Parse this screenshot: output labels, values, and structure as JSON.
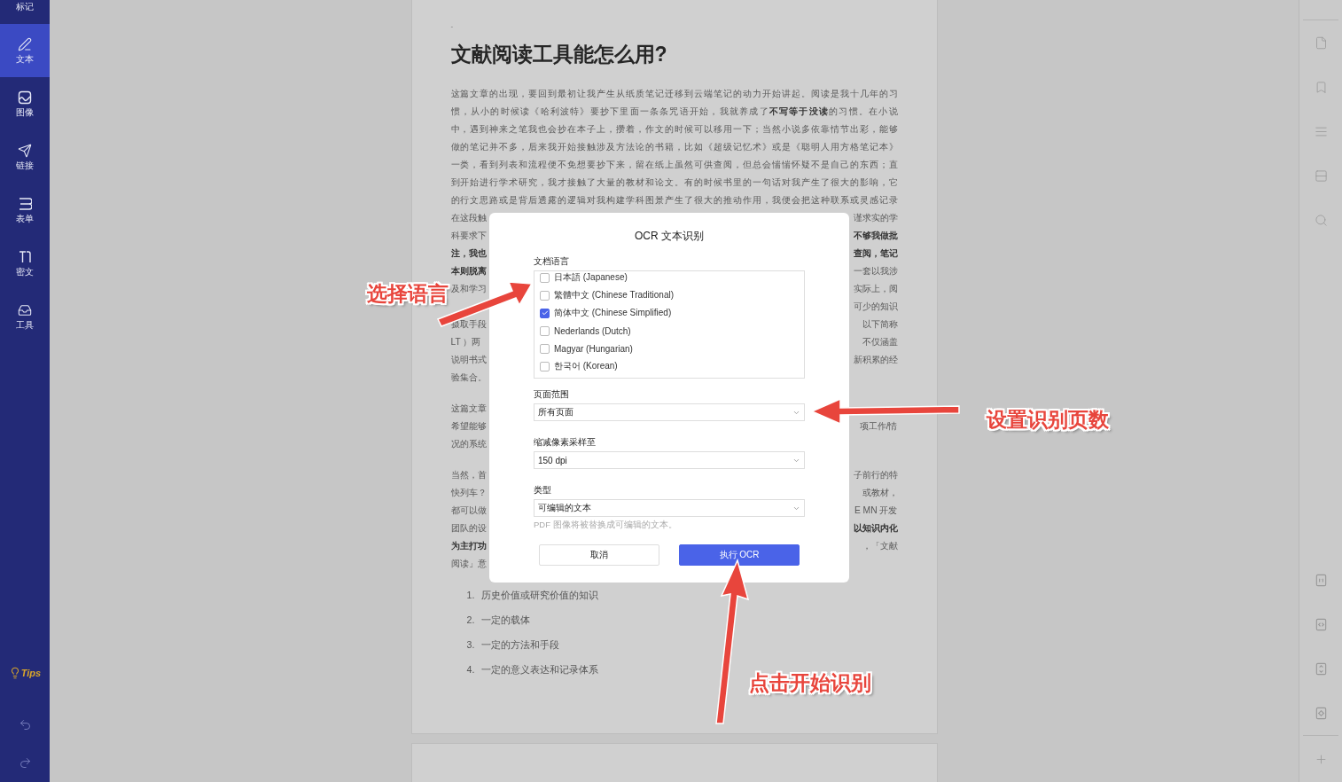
{
  "left_sidebar": {
    "items": [
      {
        "label": "标记",
        "selected": false
      },
      {
        "label": "文本",
        "selected": true
      },
      {
        "label": "图像",
        "selected": false
      },
      {
        "label": "链接",
        "selected": false
      },
      {
        "label": "表单",
        "selected": false
      },
      {
        "label": "密文",
        "selected": false
      },
      {
        "label": "工具",
        "selected": false
      }
    ],
    "tips": "Tips"
  },
  "document": {
    "marker": "-",
    "title": "文献阅读工具能怎么用?",
    "paragraphs": [
      [
        {
          "text": "这篇文章的出现，要回到最初让我产生从纸质笔记迁移到云端笔记的动力开始讲起。阅读是我十几年的习"
        },
        {
          "text": "惯，从小的时候读《哈利波特》要抄下里面一条条咒语开始，我就养成了**不写等于没读**的习惯。在小说"
        },
        {
          "text": "中，遇到神来之笔我也会抄在本子上，攒着，作文的时候可以移用一下；当然小说多依靠情节出彩，能够"
        },
        {
          "text": "做的笔记并不多，后来我开始接触涉及方法论的书籍，比如《超级记忆术》或是《聪明人用方格笔记本》"
        },
        {
          "text": "一类，看到列表和流程便不免想要抄下来，留在纸上虽然可供查阅，但总会惴惴怀疑不是自己的东西；直"
        },
        {
          "text": "到开始进行学术研究，我才接触了大量的教材和论文。有的时候书里的一句话对我产生了很大的影响，它"
        },
        {
          "text": "的行文思路或是背后透露的逻辑对我构建学科图景产生了很大的推动作用，我便会把这种联系或灵感记录"
        },
        {
          "left": "在这段触",
          "right": "谨求实的学"
        },
        {
          "left": "科要求下",
          "right": "**不够我做批**"
        },
        {
          "left": "**注，我也**",
          "right": "**查阅，笔记**"
        },
        {
          "left": "**本则脱离**",
          "right": "一套以我涉"
        },
        {
          "left": "及和学习",
          "right": "实际上，阅"
        },
        {
          "right": "可少的知识"
        },
        {
          "left": "摄取手段",
          "right": "以下简称"
        },
        {
          "left": "LT ）两",
          "right": "不仅涵盖"
        },
        {
          "left": "说明书式",
          "right": "新积累的经"
        },
        {
          "left": "验集合。"
        }
      ],
      [
        {
          "left": "这篇文章"
        },
        {
          "left": "希望能够",
          "right": "项工作/情"
        },
        {
          "left": "况的系统"
        }
      ],
      [
        {
          "left": "当然，首",
          "right": "子前行的特"
        },
        {
          "left": "快列车？",
          "right": "或教材，"
        },
        {
          "left": "都可以做",
          "right": "E MN 开发"
        },
        {
          "left": "团队的设",
          "right": "**以知识内化**"
        },
        {
          "left": "**为主打功**",
          "right": "，「文献"
        },
        {
          "left": "阅读」意"
        }
      ]
    ],
    "list": [
      {
        "number": "1.",
        "text": "历史价值或研究价值的知识"
      },
      {
        "number": "2.",
        "text": "一定的载体"
      },
      {
        "number": "3.",
        "text": "一定的方法和手段"
      },
      {
        "number": "4.",
        "text": "一定的意义表达和记录体系"
      }
    ]
  },
  "dialog": {
    "title": "OCR 文本识别",
    "language_label": "文档语言",
    "languages": [
      {
        "label": "日本語 (Japanese)",
        "checked": false
      },
      {
        "label": "繁體中文 (Chinese Traditional)",
        "checked": false
      },
      {
        "label": "简体中文 (Chinese Simplified)",
        "checked": true
      },
      {
        "label": "Nederlands (Dutch)",
        "checked": false
      },
      {
        "label": "Magyar (Hungarian)",
        "checked": false
      },
      {
        "label": "한국어 (Korean)",
        "checked": false
      }
    ],
    "fields": [
      {
        "label": "页面范围",
        "value": "所有页面"
      },
      {
        "label": "缩减像素采样至",
        "value": "150 dpi"
      },
      {
        "label": "类型",
        "value": "可编辑的文本",
        "hint": "PDF 图像将被替换成可编辑的文本。"
      }
    ],
    "buttons": [
      {
        "label": "取消",
        "kind": "secondary"
      },
      {
        "label": "执行 OCR",
        "kind": "primary"
      }
    ]
  },
  "annotations": [
    {
      "text": "选择语言"
    },
    {
      "text": "设置识别页数"
    },
    {
      "text": "点击开始识别"
    }
  ]
}
